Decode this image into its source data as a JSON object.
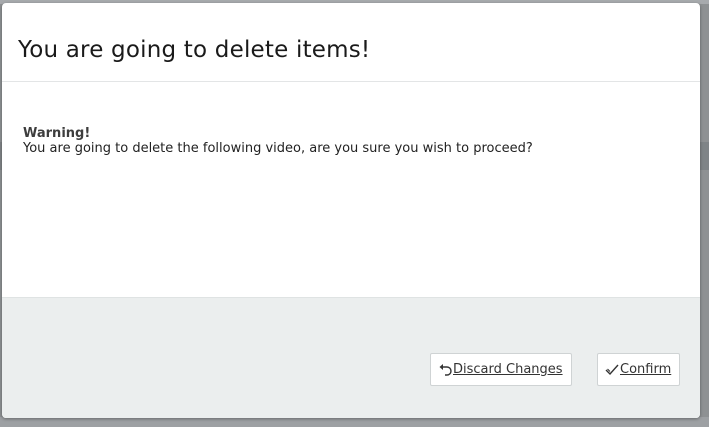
{
  "dialog": {
    "title": "You are going to delete items!",
    "warning_heading": "Warning!",
    "warning_message": "You are going to delete the following video, are you sure you wish to proceed?"
  },
  "footer": {
    "discard_label": "Discard Changes",
    "discard_icon": "undo-icon",
    "confirm_label": "Confirm",
    "confirm_icon": "check-icon"
  },
  "colors": {
    "backdrop": "#8e9193",
    "footer_bg": "#ebeeee",
    "modal_bg": "#ffffff"
  }
}
